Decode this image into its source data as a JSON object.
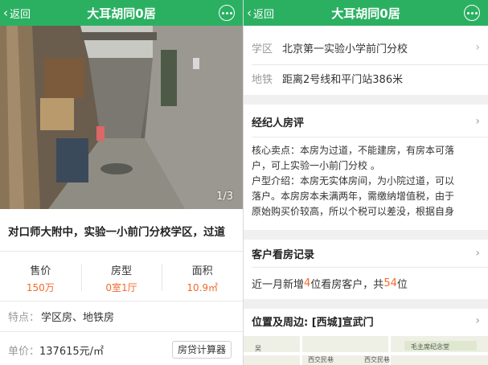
{
  "left": {
    "nav": {
      "back": "返回",
      "title": "大耳胡同0居"
    },
    "photo": {
      "counter": "1/3"
    },
    "listing_title": "对口师大附中，实验一小前门分校学区，过道",
    "stats": [
      {
        "label": "售价",
        "value": "150万"
      },
      {
        "label": "房型",
        "value": "0室1厅"
      },
      {
        "label": "面积",
        "value": "10.9㎡"
      }
    ],
    "features": {
      "key": "特点：",
      "value": "学区房、地铁房"
    },
    "unit_price": {
      "key": "单价：",
      "value": "137615元/㎡"
    },
    "calc_button": "房贷计算器"
  },
  "right": {
    "nav": {
      "back": "返回",
      "title": "大耳胡同0居"
    },
    "school": {
      "key": "学区",
      "value": "北京第一实验小学前门分校"
    },
    "subway": {
      "key": "地铁",
      "value": "距离2号线和平门站386米"
    },
    "agent_review": {
      "heading": "经纪人房评",
      "line1": "核心卖点：本房为过道，不能建房，有房本可落",
      "line2": "户，可上实验一小前门分校 。",
      "line3": "户型介绍：本房无实体房间，为小院过道，可以",
      "line4": "落户。本房房本未满两年，需缴纳增值税，由于",
      "line5": "原始购买价较高，所以个税可以差没，根据自身"
    },
    "viewings": {
      "heading": "客户看房记录",
      "prefix": "近一月新增",
      "count": "4",
      "middle": "位看房客户，共",
      "total": "54",
      "suffix": "位"
    },
    "location": {
      "heading": "位置及周边: [西城]宣武门",
      "map_labels": [
        "西交民巷",
        "西交民巷",
        "毛主席纪念堂",
        "吴"
      ]
    }
  },
  "colors": {
    "nav_green": "#2bb062",
    "accent_orange": "#f26a2c"
  }
}
